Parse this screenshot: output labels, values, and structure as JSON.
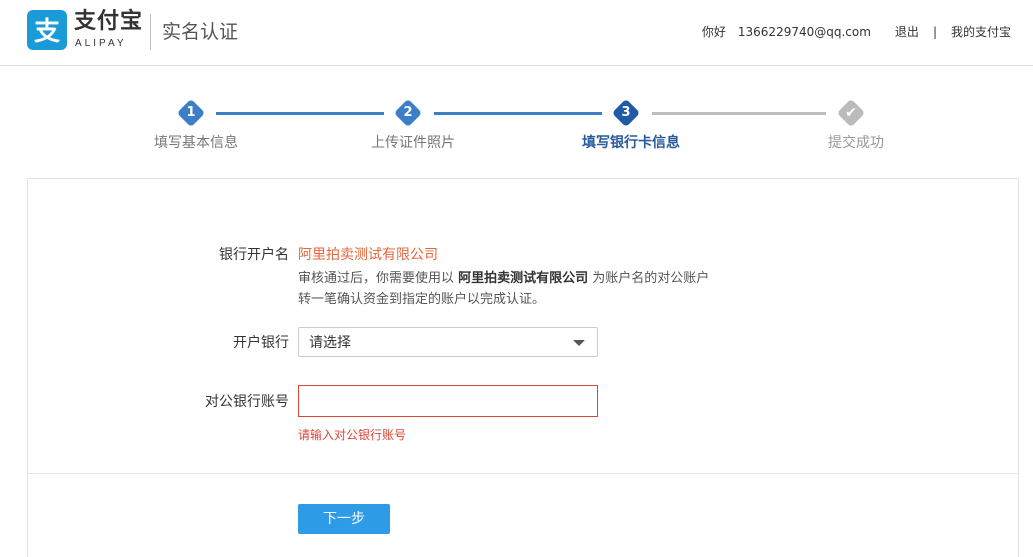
{
  "header": {
    "logo_cn": "支付宝",
    "logo_en": "ALIPAY",
    "page_title": "实名认证",
    "greeting": "你好",
    "user_email": "1366229740@qq.com",
    "logout": "退出",
    "separator": "|",
    "my_alipay": "我的支付宝"
  },
  "steps": [
    {
      "number": "1",
      "label": "填写基本信息",
      "state": "done"
    },
    {
      "number": "2",
      "label": "上传证件照片",
      "state": "done"
    },
    {
      "number": "3",
      "label": "填写银行卡信息",
      "state": "active"
    },
    {
      "number": "✔",
      "label": "提交成功",
      "state": "pending"
    }
  ],
  "form": {
    "account_name_label": "银行开户名",
    "account_name_value": "阿里拍卖测试有限公司",
    "desc_prefix": "审核通过后，你需要使用以 ",
    "desc_company": "阿里拍卖测试有限公司",
    "desc_suffix": " 为账户名的对公账户转一笔确认资金到指定的账户以完成认证。",
    "bank_label": "开户银行",
    "bank_value": "请选择",
    "account_number_label": "对公银行账号",
    "account_number_value": "",
    "account_number_error": "请输入对公银行账号",
    "next_button": "下一步"
  },
  "colors": {
    "brand_blue": "#1a9bd7",
    "step_done": "#3d7fc6",
    "step_active": "#1e5aa6",
    "step_pending": "#bbbbbb",
    "highlight_orange": "#e5663d",
    "error_red": "#d8473a",
    "button_blue": "#2e9be7"
  }
}
